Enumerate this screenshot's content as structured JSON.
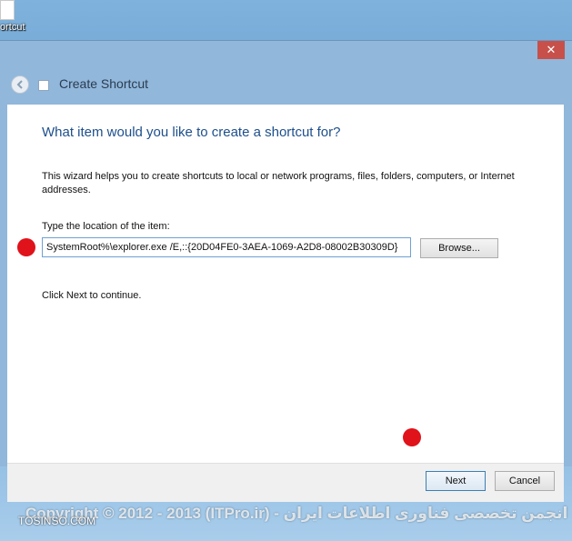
{
  "desktop": {
    "shortcut_label": "ortcut"
  },
  "window": {
    "close_label": "✕",
    "title": "Create Shortcut"
  },
  "wizard": {
    "heading": "What item would you like to create a shortcut for?",
    "description": "This wizard helps you to create shortcuts to local or network programs, files, folders, computers, or Internet addresses.",
    "location_label": "Type the location of the item:",
    "location_value": "SystemRoot%\\explorer.exe /E,::{20D04FE0-3AEA-1069-A2D8-08002B30309D}",
    "browse_label": "Browse...",
    "continue_text": "Click Next to continue.",
    "next_label": "Next",
    "cancel_label": "Cancel"
  },
  "annotation": {
    "marker_color": "#e0121a"
  },
  "watermark": {
    "text": "Copyright © 2012 - 2013 (ITPro.ir) - انجمن تخصصی فناوری اطلاعات ایران",
    "site": "TOSINSO.COM"
  }
}
